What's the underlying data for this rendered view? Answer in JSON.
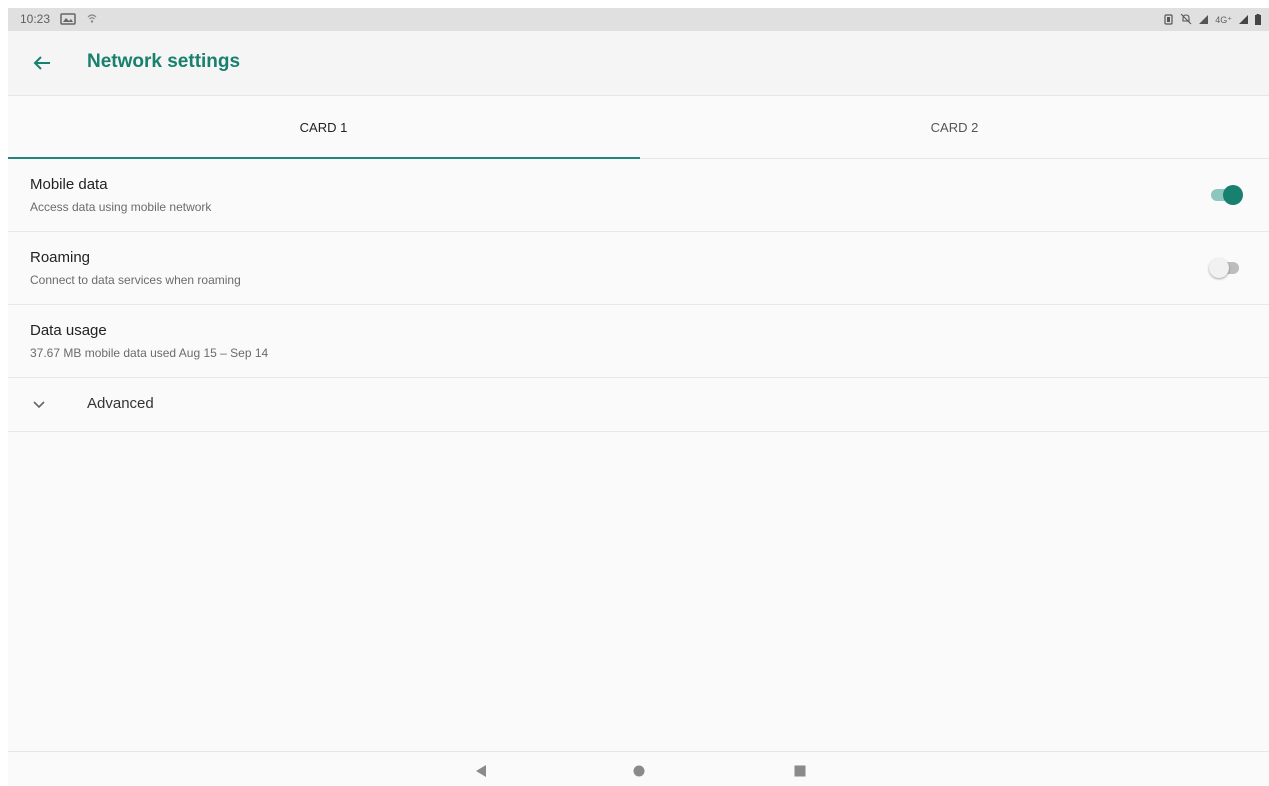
{
  "status_bar": {
    "time": "10:23",
    "network_type": "4G⁺",
    "icons": [
      "photo-notification-icon",
      "wifi-hotspot-icon",
      "vibrate-icon",
      "mute-icon",
      "signal-icon",
      "battery-icon"
    ]
  },
  "app_bar": {
    "title": "Network settings",
    "back_icon": "arrow-back-icon",
    "accent_color": "#17806e"
  },
  "tabs": [
    {
      "label": "CARD 1",
      "selected": true
    },
    {
      "label": "CARD 2",
      "selected": false
    }
  ],
  "settings": {
    "mobile_data": {
      "title": "Mobile data",
      "summary": "Access data using mobile network",
      "enabled": true
    },
    "roaming": {
      "title": "Roaming",
      "summary": "Connect to data services when roaming",
      "enabled": false
    },
    "data_usage": {
      "title": "Data usage",
      "summary": "37.67 MB mobile data used Aug 15 – Sep 14"
    },
    "advanced": {
      "label": "Advanced",
      "icon": "chevron-down-icon"
    }
  },
  "nav_bar": {
    "buttons": [
      "back-triangle-icon",
      "home-circle-icon",
      "recents-square-icon"
    ]
  }
}
